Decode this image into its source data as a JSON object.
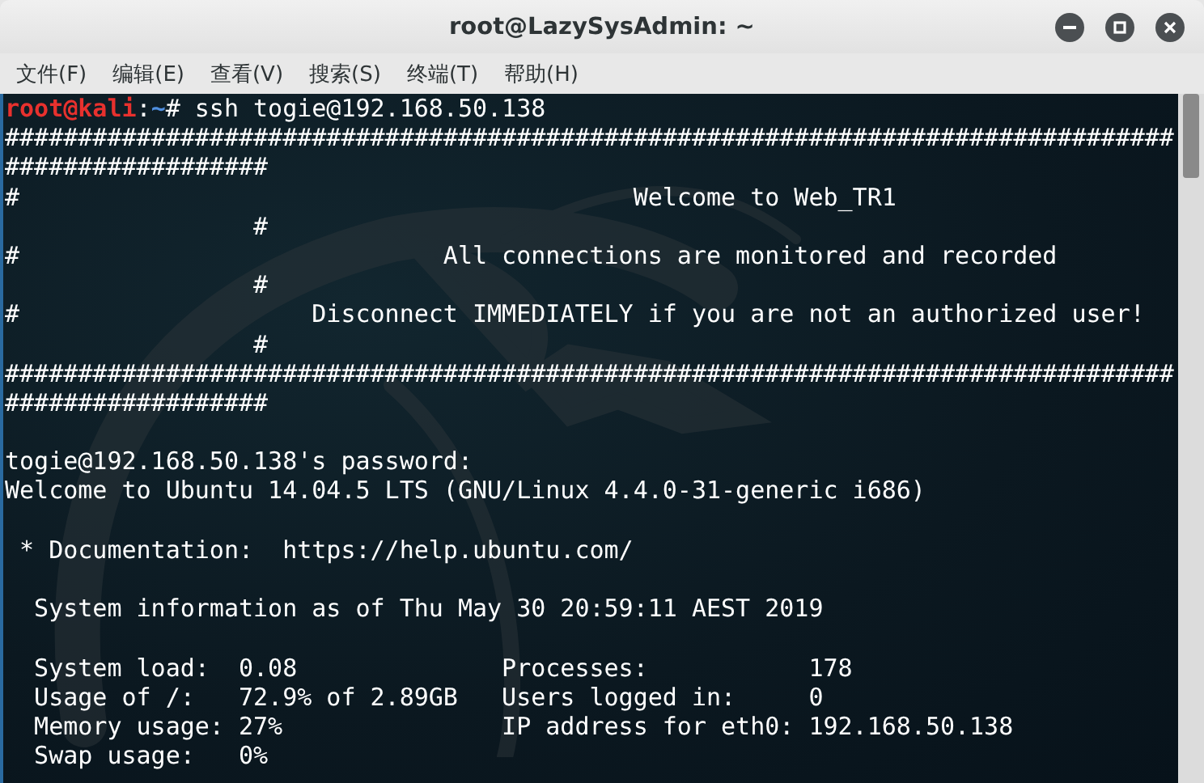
{
  "window": {
    "title": "root@LazySysAdmin: ~"
  },
  "menu": [
    {
      "label": "文件(F)"
    },
    {
      "label": "编辑(E)"
    },
    {
      "label": "查看(V)"
    },
    {
      "label": "搜索(S)"
    },
    {
      "label": "终端(T)"
    },
    {
      "label": "帮助(H)"
    }
  ],
  "prompt": {
    "user": "root@kali",
    "separator": ":",
    "path": "~",
    "symbol": "#",
    "command": "ssh togie@192.168.50.138"
  },
  "lines": [
    {
      "kind": "text",
      "text": "################################################################################"
    },
    {
      "kind": "text",
      "text": "##################"
    },
    {
      "kind": "text",
      "text": "#                                          Welcome to Web_TR1"
    },
    {
      "kind": "text",
      "text": "                 #"
    },
    {
      "kind": "text",
      "text": "#                             All connections are monitored and recorded"
    },
    {
      "kind": "text",
      "text": "                 #"
    },
    {
      "kind": "text",
      "text": "#                    Disconnect IMMEDIATELY if you are not an authorized user!"
    },
    {
      "kind": "text",
      "text": "                 #"
    },
    {
      "kind": "text",
      "text": "################################################################################"
    },
    {
      "kind": "text",
      "text": "##################"
    },
    {
      "kind": "blank"
    },
    {
      "kind": "text",
      "text": "togie@192.168.50.138's password:"
    },
    {
      "kind": "text",
      "text": "Welcome to Ubuntu 14.04.5 LTS (GNU/Linux 4.4.0-31-generic i686)"
    },
    {
      "kind": "blank"
    },
    {
      "kind": "text",
      "text": " * Documentation:  https://help.ubuntu.com/"
    },
    {
      "kind": "blank"
    },
    {
      "kind": "text",
      "text": "  System information as of Thu May 30 20:59:11 AEST 2019"
    },
    {
      "kind": "blank"
    },
    {
      "kind": "text",
      "text": "  System load:  0.08              Processes:           178"
    },
    {
      "kind": "text",
      "text": "  Usage of /:   72.9% of 2.89GB   Users logged in:     0"
    },
    {
      "kind": "text",
      "text": "  Memory usage: 27%               IP address for eth0: 192.168.50.138"
    },
    {
      "kind": "text",
      "text": "  Swap usage:   0%"
    }
  ]
}
